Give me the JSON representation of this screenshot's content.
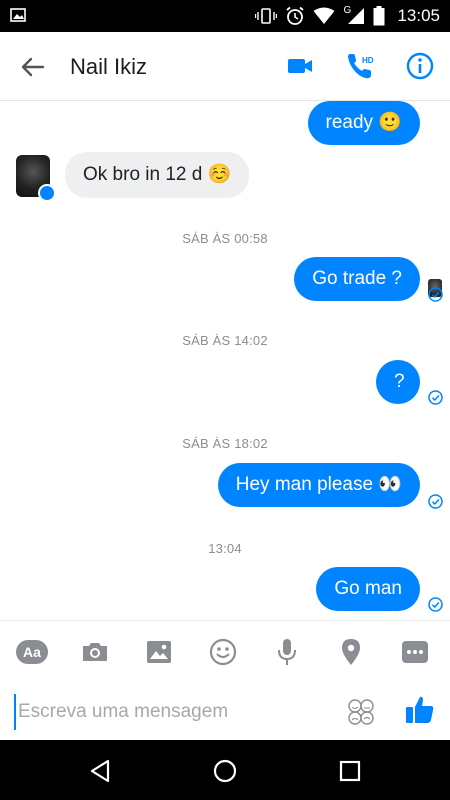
{
  "status_bar": {
    "time": "13:05",
    "network_label": "G",
    "icons": [
      "image-icon",
      "vibrate-icon",
      "alarm-icon",
      "wifi-icon",
      "signal-icon",
      "battery-icon"
    ]
  },
  "header": {
    "title": "Nail Ikiz",
    "icons": [
      "back-arrow-icon",
      "video-call-icon",
      "hd-call-icon",
      "info-icon"
    ],
    "hd_label": "HD",
    "accent": "#0084ff"
  },
  "chat": {
    "messages": [
      {
        "sender": "me",
        "text": "ready 🙂"
      },
      {
        "sender": "contact",
        "text": "Ok bro in 12 d ☺️"
      },
      {
        "timestamp": "SÁB ÀS 00:58"
      },
      {
        "sender": "me",
        "text": "Go trade ?"
      },
      {
        "timestamp": "SÁB ÀS 14:02"
      },
      {
        "sender": "me",
        "text": "?"
      },
      {
        "timestamp": "SÁB ÀS 18:02"
      },
      {
        "sender": "me",
        "text": "Hey man please 👀"
      },
      {
        "timestamp": "13:04"
      },
      {
        "sender": "me",
        "text": "Go man"
      }
    ],
    "outgoing_color": "#0084ff",
    "incoming_color": "#eeeff1"
  },
  "toolbar": {
    "aa_label": "Aa",
    "icons": [
      "text-format-icon",
      "camera-icon",
      "gallery-icon",
      "emoji-icon",
      "microphone-icon",
      "location-icon",
      "more-icon"
    ]
  },
  "composer": {
    "placeholder": "Escreva uma mensagem",
    "value": "",
    "icons": [
      "emoji-faces-icon",
      "thumbs-up-icon"
    ]
  },
  "nav_bar": {
    "icons": [
      "back-nav-icon",
      "home-nav-icon",
      "recents-nav-icon"
    ]
  }
}
